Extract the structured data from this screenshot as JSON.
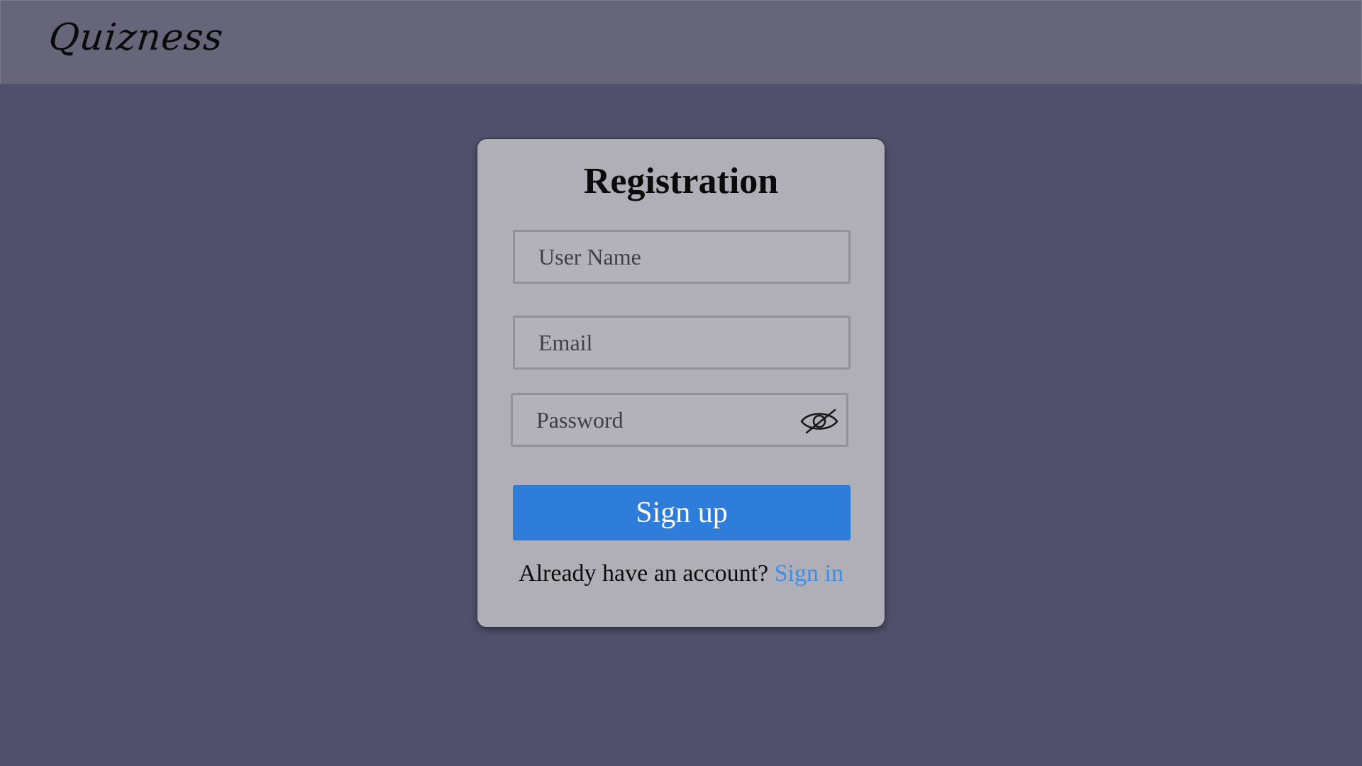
{
  "app": {
    "logo_text": "Quizness"
  },
  "registration": {
    "title": "Registration",
    "username": {
      "placeholder": "User Name",
      "value": ""
    },
    "email": {
      "placeholder": "Email",
      "value": ""
    },
    "password": {
      "placeholder": "Password",
      "value": "",
      "visibility_icon": "eye-slash-icon"
    },
    "submit_label": "Sign up",
    "already_text": "Already have an account?",
    "signin_link": "Sign in"
  },
  "colors": {
    "background": "#51506c",
    "header": "#666579",
    "card": "#b0afb8",
    "primary_button": "#2f7ddb",
    "link": "#3f8ee2"
  }
}
